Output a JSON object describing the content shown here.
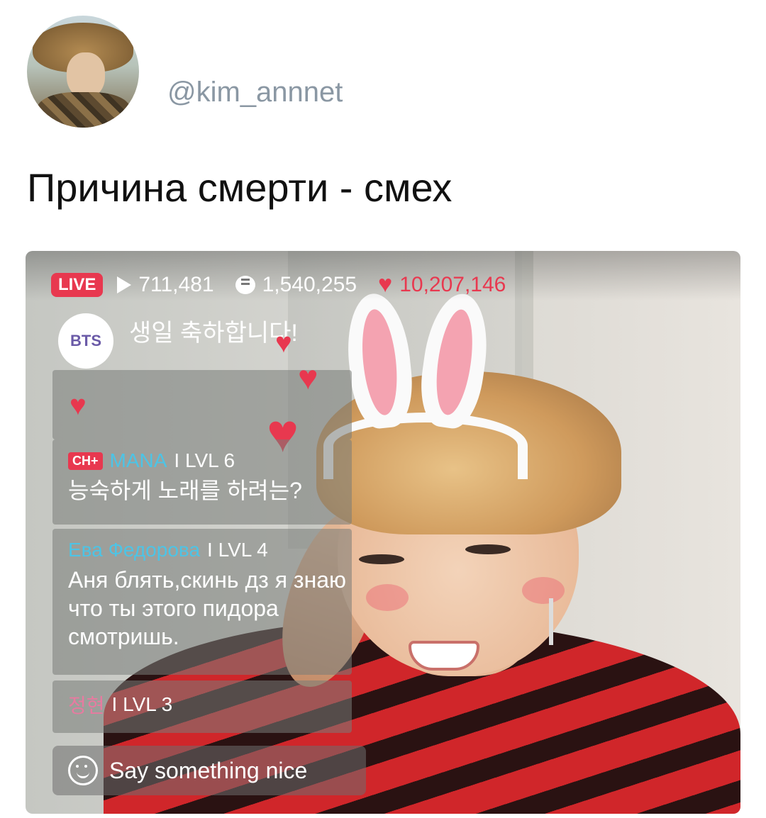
{
  "post": {
    "username": "@kim_annnet",
    "text": "Причина смерти - смех"
  },
  "live": {
    "badge": "LIVE",
    "plays": "711,481",
    "comments": "1,540,255",
    "hearts": "10,207,146",
    "brand_logo": "BTS",
    "brand_message": "생일 축하합니다!",
    "chats": [
      {
        "tag": "CH+",
        "name": "MANA",
        "level": "I LVL 6",
        "message": "능숙하게 노래를 하려는?"
      },
      {
        "name": "Ева Федорова",
        "level": "I LVL 4",
        "message": "Аня блять,скинь дз я знаю что ты этого пидора смотришь."
      },
      {
        "name": "정현",
        "level": "I LVL 3"
      }
    ],
    "input_placeholder": "Say something nice",
    "colors": {
      "live_red": "#e8384f",
      "name_blue": "#4cc4e6"
    }
  }
}
